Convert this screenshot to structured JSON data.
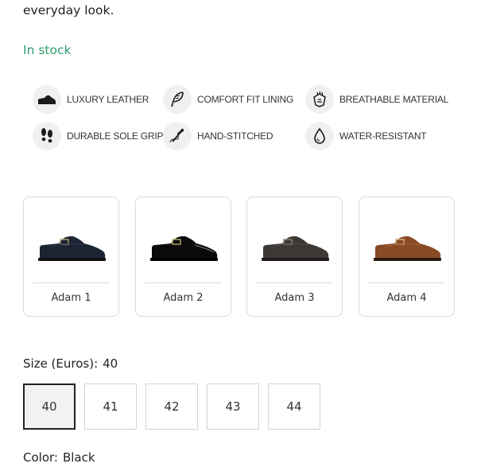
{
  "product": {
    "description_tail": "everyday look.",
    "stock_status": "In stock",
    "features": [
      {
        "label": "LUXURY LEATHER",
        "icon": "shoe-icon"
      },
      {
        "label": "COMFORT FIT LINING",
        "icon": "feather-icon"
      },
      {
        "label": "BREATHABLE MATERIAL",
        "icon": "breathable-icon"
      },
      {
        "label": "DURABLE SOLE GRIP",
        "icon": "footprints-icon"
      },
      {
        "label": "HAND-STITCHED",
        "icon": "needle-thread-icon"
      },
      {
        "label": "WATER-RESISTANT",
        "icon": "water-drop-icon"
      }
    ],
    "variants": [
      {
        "name": "Adam 1",
        "color": "#1c2433"
      },
      {
        "name": "Adam 2",
        "color": "#0a0a0a"
      },
      {
        "name": "Adam 3",
        "color": "#3d3835"
      },
      {
        "name": "Adam 4",
        "color": "#8a4a26"
      }
    ],
    "size": {
      "label": "Size (Euros):",
      "selected": "40",
      "options": [
        "40",
        "41",
        "42",
        "43",
        "44"
      ]
    },
    "color": {
      "label": "Color:",
      "value": "Black"
    },
    "accent_color": "#2e9e6e"
  }
}
